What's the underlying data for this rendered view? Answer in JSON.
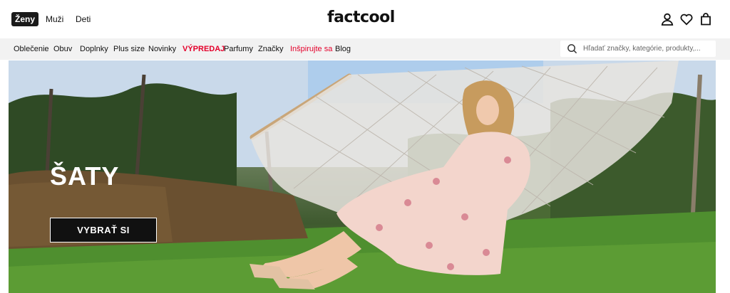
{
  "header": {
    "genders": [
      {
        "label": "Ženy",
        "active": true
      },
      {
        "label": "Muži",
        "active": false
      },
      {
        "label": "Deti",
        "active": false
      }
    ],
    "logo": "factcool",
    "icons": [
      "user-icon",
      "heart-icon",
      "bag-icon"
    ]
  },
  "nav": {
    "items": [
      {
        "label": "Oblečenie"
      },
      {
        "label": "Obuv"
      },
      {
        "label": "Doplnky"
      },
      {
        "label": "Plus size"
      },
      {
        "label": "Novinky"
      },
      {
        "label": "VÝPREDAJ",
        "accent": "#e4002b"
      },
      {
        "label": "Parfumy"
      },
      {
        "label": "Značky"
      },
      {
        "label": "Inšpirujte sa",
        "accent": "#e4002b"
      },
      {
        "label": "Blog"
      }
    ]
  },
  "search": {
    "placeholder": "Hľadať značky, kategórie, produkty,..."
  },
  "hero": {
    "title": "ŠATY",
    "cta": "VYBRAŤ SI"
  },
  "colors": {
    "accent_red": "#e4002b",
    "dark": "#111111",
    "nav_bg": "#f2f2f2"
  }
}
